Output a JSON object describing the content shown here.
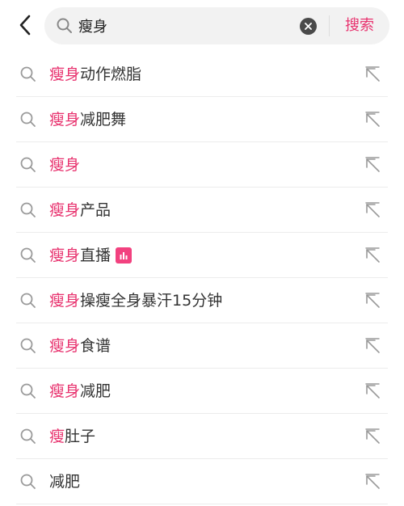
{
  "search": {
    "query": "瘦身",
    "submit_label": "搜索"
  },
  "colors": {
    "accent": "#e8336f",
    "text": "#333333",
    "icon": "#9a9a9a",
    "field_bg": "#f2f2f2"
  },
  "icons": {
    "back": "chevron-left-icon",
    "search": "magnifier-icon",
    "clear": "clear-x-icon",
    "fill": "arrow-up-left-icon",
    "live": "bar-chart-icon"
  },
  "suggestions": [
    {
      "highlight": "瘦身",
      "rest": "动作燃脂",
      "badge": false
    },
    {
      "highlight": "瘦身",
      "rest": "减肥舞",
      "badge": false
    },
    {
      "highlight": "瘦身",
      "rest": "",
      "badge": false
    },
    {
      "highlight": "瘦身",
      "rest": "产品",
      "badge": false
    },
    {
      "highlight": "瘦身",
      "rest": "直播",
      "badge": true
    },
    {
      "highlight": "瘦身",
      "rest": "操瘦全身暴汗15分钟",
      "badge": false
    },
    {
      "highlight": "瘦身",
      "rest": "食谱",
      "badge": false
    },
    {
      "highlight": "瘦身",
      "rest": "减肥",
      "badge": false
    },
    {
      "highlight": "瘦",
      "rest": "肚子",
      "badge": false
    },
    {
      "highlight": "",
      "rest": "减肥",
      "badge": false
    }
  ]
}
